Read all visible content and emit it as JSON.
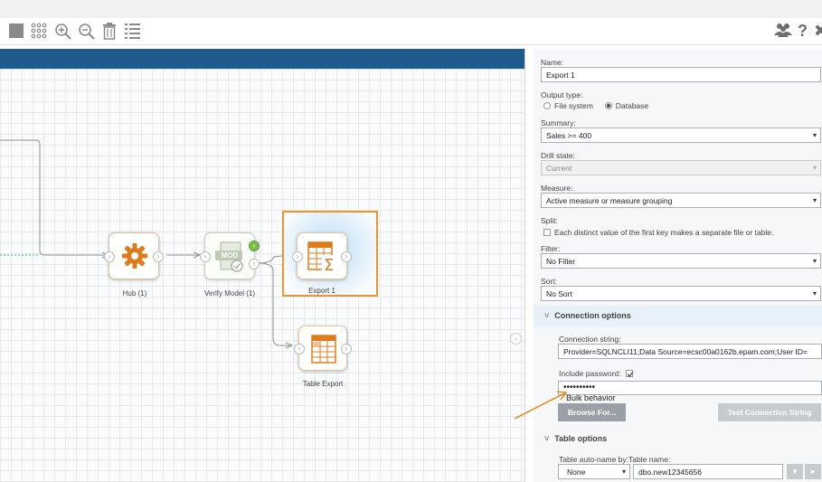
{
  "form": {
    "name_label": "Name:",
    "name_value": "Export 1",
    "output_type_label": "Output type:",
    "output_type_options": [
      "File system",
      "Database"
    ],
    "output_type_selected": "Database",
    "summary_label": "Summary:",
    "summary_value": "Sales >= 400",
    "drill_state_label": "Drill state:",
    "drill_state_value": "Current",
    "measure_label": "Measure:",
    "measure_value": "Active measure or measure grouping",
    "split_label": "Split:",
    "split_checkbox_label": "Each distinct value of the first key makes a separate file or table.",
    "filter_label": "Filter:",
    "filter_value": "No Filter",
    "sort_label": "Sort:",
    "sort_value": "No Sort"
  },
  "connection": {
    "section_title": "Connection options",
    "string_label": "Connection string:",
    "string_value": "Provider=SQLNCLI11;Data Source=ecsc00a0162b.epam.com;User ID=",
    "include_password_label": "Include password:",
    "include_password_checked": true,
    "password_value": "••••••••••",
    "bulk_behavior_text": "Bulk behavior",
    "browse_button": "Browse For...",
    "test_button": "Test Connection String"
  },
  "table_options": {
    "section_title": "Table options",
    "auto_name_label": "Table auto-name by:",
    "table_name_label": "Table name:",
    "auto_name_value": "None",
    "table_name_value": "dbo.new12345656"
  },
  "nodes": {
    "hub": "Hub (1)",
    "verify_model": "Verify Model (1)",
    "verify_model_badge": "MOD",
    "export1": "Export 1",
    "table_export": "Table Export"
  },
  "icons": {
    "caret": "▾",
    "section_chevron": "˅",
    "help": "?",
    "close": "✖",
    "users": "users-icon",
    "arrow_right": "›",
    "arrow_right_btn": "▸"
  },
  "colors": {
    "accent_orange": "#e07b1c",
    "nav_blue": "#1e5a8c",
    "button_gray": "#9aa0a5",
    "selection_border": "#e8962f",
    "section_bg": "#e8f1f7"
  }
}
